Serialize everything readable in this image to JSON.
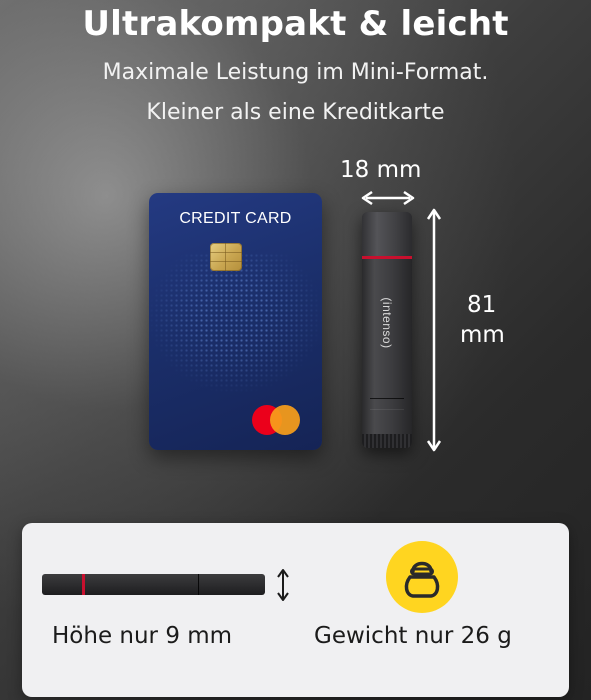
{
  "header": {
    "title": "Ultrakompakt & leicht",
    "subtitle_line1": "Maximale Leistung im Mini-Format.",
    "subtitle_line2": "Kleiner als eine Kreditkarte"
  },
  "card": {
    "label": "CREDIT CARD"
  },
  "stick": {
    "brand": "(intenso)"
  },
  "dimensions": {
    "width": "18 mm",
    "length_value": "81",
    "length_unit": "mm"
  },
  "features": {
    "height_caption": "Höhe nur 9 mm",
    "weight_caption": "Gewicht nur 26 g"
  },
  "colors": {
    "accent_yellow": "#ffd520",
    "stick_red": "#c8102e",
    "card_blue": "#1b2f6b"
  },
  "icons": {
    "weight": "kettlebell-icon",
    "height_arrow": "double-arrow-vertical-icon"
  }
}
